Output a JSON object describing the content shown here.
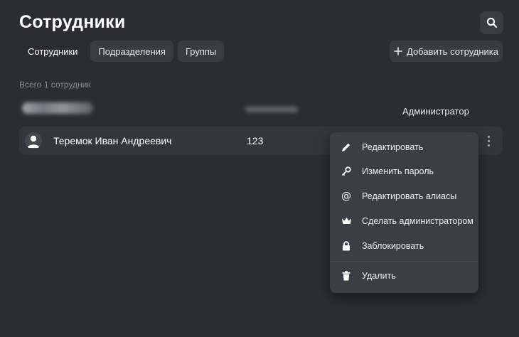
{
  "page": {
    "title": "Сотрудники"
  },
  "tabs": [
    {
      "label": "Сотрудники",
      "active": true
    },
    {
      "label": "Подразделения",
      "active": false
    },
    {
      "label": "Группы",
      "active": false
    }
  ],
  "actions": {
    "add_label": "Добавить сотрудника"
  },
  "summary": {
    "total": "Всего 1 сотрудник"
  },
  "header_row": {
    "role": "Администратор"
  },
  "employees": [
    {
      "name": "Теремок Иван Андреевич",
      "number": "123"
    }
  ],
  "context_menu": {
    "items": [
      {
        "label": "Редактировать",
        "icon": "pencil-icon"
      },
      {
        "label": "Изменить пароль",
        "icon": "key-icon"
      },
      {
        "label": "Редактировать алиасы",
        "icon": "at-icon"
      },
      {
        "label": "Сделать администратором",
        "icon": "crown-icon"
      },
      {
        "label": "Заблокировать",
        "icon": "lock-icon"
      },
      {
        "label": "Удалить",
        "icon": "trash-icon"
      }
    ]
  },
  "colors": {
    "background": "#2b2d33",
    "surface": "#3a3c43",
    "row": "#34363d",
    "menu": "#3b3e45",
    "muted_text": "#8a8d94"
  }
}
